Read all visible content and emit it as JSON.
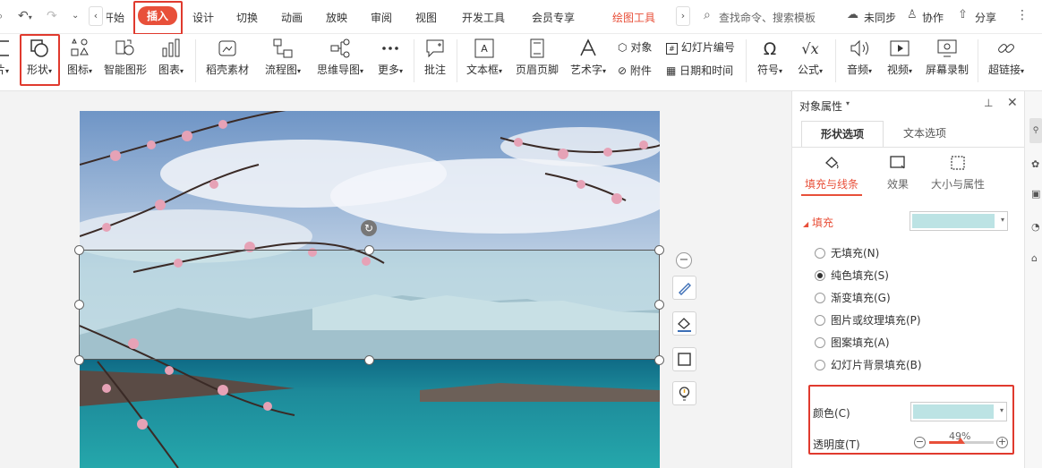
{
  "tabs": {
    "start": "开始",
    "insert": "插入",
    "design": "设计",
    "transition": "切换",
    "animation": "动画",
    "slideshow": "放映",
    "review": "审阅",
    "view": "视图",
    "developer": "开发工具",
    "member": "会员专享",
    "draw_tools": "绘图工具",
    "search": "查找命令、搜索模板",
    "unsync": "未同步",
    "collab": "协作",
    "share": "分享"
  },
  "ribbon": {
    "shape": "形状",
    "icon": "图标",
    "smart": "智能图形",
    "chart": "图表",
    "material": "稻壳素材",
    "flow": "流程图",
    "mind": "思维导图",
    "more": "更多",
    "comment": "批注",
    "textbox": "文本框",
    "header": "页眉页脚",
    "art": "艺术字",
    "object": "对象",
    "slide_no": "幻灯片编号",
    "attach": "附件",
    "datetime": "日期和时间",
    "symbol": "符号",
    "formula": "公式",
    "audio": "音频",
    "video": "视频",
    "record": "屏幕录制",
    "link": "超链接"
  },
  "panel": {
    "title": "对象属性",
    "tab_shape": "形状选项",
    "tab_text": "文本选项",
    "sub_fill": "填充与线条",
    "sub_effect": "效果",
    "sub_size": "大小与属性",
    "fill_section": "填充",
    "options": [
      "无填充(N)",
      "纯色填充(S)",
      "渐变填充(G)",
      "图片或纹理填充(P)",
      "图案填充(A)",
      "幻灯片背景填充(B)"
    ],
    "color_label": "颜色(C)",
    "transparency_label": "透明度(T)",
    "transparency_value": "49%",
    "transparency": 0.49
  },
  "colors": {
    "accent": "#e8503a",
    "fill_swatch": "#bce3e4",
    "highlight_box": "#e03a2e"
  }
}
